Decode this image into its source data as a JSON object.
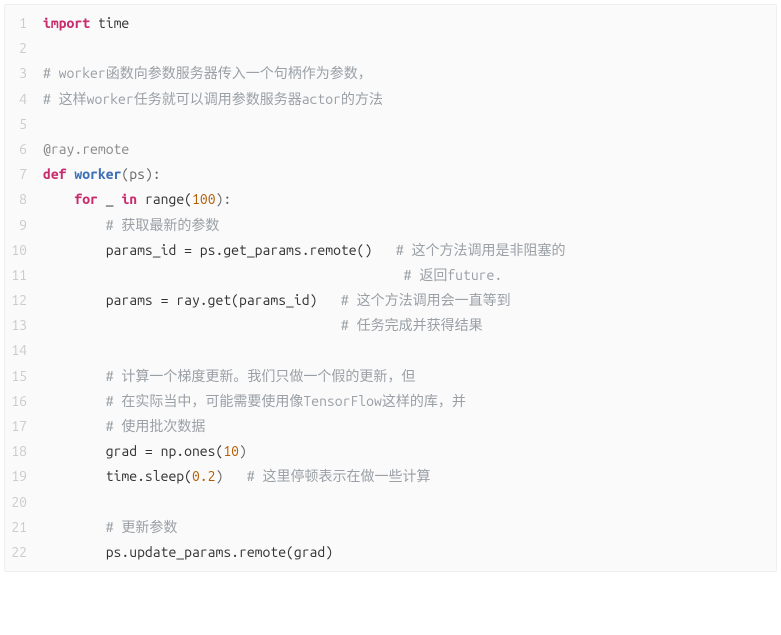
{
  "code": {
    "lines": [
      {
        "n": 1,
        "tokens": [
          {
            "t": "import",
            "c": "keyword"
          },
          {
            "t": " time",
            "c": "ident"
          }
        ]
      },
      {
        "n": 2,
        "tokens": []
      },
      {
        "n": 3,
        "tokens": [
          {
            "t": "# worker函数向参数服务器传入一个句柄作为参数，",
            "c": "comment"
          }
        ]
      },
      {
        "n": 4,
        "tokens": [
          {
            "t": "# 这样worker任务就可以调用参数服务器actor的方法",
            "c": "comment"
          }
        ]
      },
      {
        "n": 5,
        "tokens": []
      },
      {
        "n": 6,
        "tokens": [
          {
            "t": "@ray.remote",
            "c": "decorator"
          }
        ]
      },
      {
        "n": 7,
        "tokens": [
          {
            "t": "def",
            "c": "keyword"
          },
          {
            "t": " ",
            "c": "ident"
          },
          {
            "t": "worker",
            "c": "funcname"
          },
          {
            "t": "(ps):",
            "c": "punct"
          }
        ]
      },
      {
        "n": 8,
        "tokens": [
          {
            "t": "    ",
            "c": "ident"
          },
          {
            "t": "for",
            "c": "keyword"
          },
          {
            "t": " _ ",
            "c": "ident"
          },
          {
            "t": "in",
            "c": "keyword"
          },
          {
            "t": " range(",
            "c": "ident"
          },
          {
            "t": "100",
            "c": "number"
          },
          {
            "t": "):",
            "c": "punct"
          }
        ]
      },
      {
        "n": 9,
        "tokens": [
          {
            "t": "        ",
            "c": "ident"
          },
          {
            "t": "# 获取最新的参数",
            "c": "comment"
          }
        ]
      },
      {
        "n": 10,
        "tokens": [
          {
            "t": "        params_id = ps.get_params.remote()   ",
            "c": "ident"
          },
          {
            "t": "# 这个方法调用是非阻塞的",
            "c": "comment"
          }
        ]
      },
      {
        "n": 11,
        "tokens": [
          {
            "t": "                                              ",
            "c": "ident"
          },
          {
            "t": "# 返回future.",
            "c": "comment"
          }
        ]
      },
      {
        "n": 12,
        "tokens": [
          {
            "t": "        params = ray.get(params_id)   ",
            "c": "ident"
          },
          {
            "t": "# 这个方法调用会一直等到",
            "c": "comment"
          }
        ]
      },
      {
        "n": 13,
        "tokens": [
          {
            "t": "                                      ",
            "c": "ident"
          },
          {
            "t": "# 任务完成并获得结果",
            "c": "comment"
          }
        ]
      },
      {
        "n": 14,
        "tokens": []
      },
      {
        "n": 15,
        "tokens": [
          {
            "t": "        ",
            "c": "ident"
          },
          {
            "t": "# 计算一个梯度更新。我们只做一个假的更新，但",
            "c": "comment"
          }
        ]
      },
      {
        "n": 16,
        "tokens": [
          {
            "t": "        ",
            "c": "ident"
          },
          {
            "t": "# 在实际当中，可能需要使用像TensorFlow这样的库，并",
            "c": "comment"
          }
        ]
      },
      {
        "n": 17,
        "tokens": [
          {
            "t": "        ",
            "c": "ident"
          },
          {
            "t": "# 使用批次数据",
            "c": "comment"
          }
        ]
      },
      {
        "n": 18,
        "tokens": [
          {
            "t": "        grad = np.ones(",
            "c": "ident"
          },
          {
            "t": "10",
            "c": "number"
          },
          {
            "t": ")",
            "c": "punct"
          }
        ]
      },
      {
        "n": 19,
        "tokens": [
          {
            "t": "        time.sleep(",
            "c": "ident"
          },
          {
            "t": "0.2",
            "c": "number"
          },
          {
            "t": ")   ",
            "c": "punct"
          },
          {
            "t": "# 这里停顿表示在做一些计算",
            "c": "comment"
          }
        ]
      },
      {
        "n": 20,
        "tokens": []
      },
      {
        "n": 21,
        "tokens": [
          {
            "t": "        ",
            "c": "ident"
          },
          {
            "t": "# 更新参数",
            "c": "comment"
          }
        ]
      },
      {
        "n": 22,
        "tokens": [
          {
            "t": "        ps.update_params.remote(grad)",
            "c": "ident"
          }
        ]
      }
    ]
  }
}
